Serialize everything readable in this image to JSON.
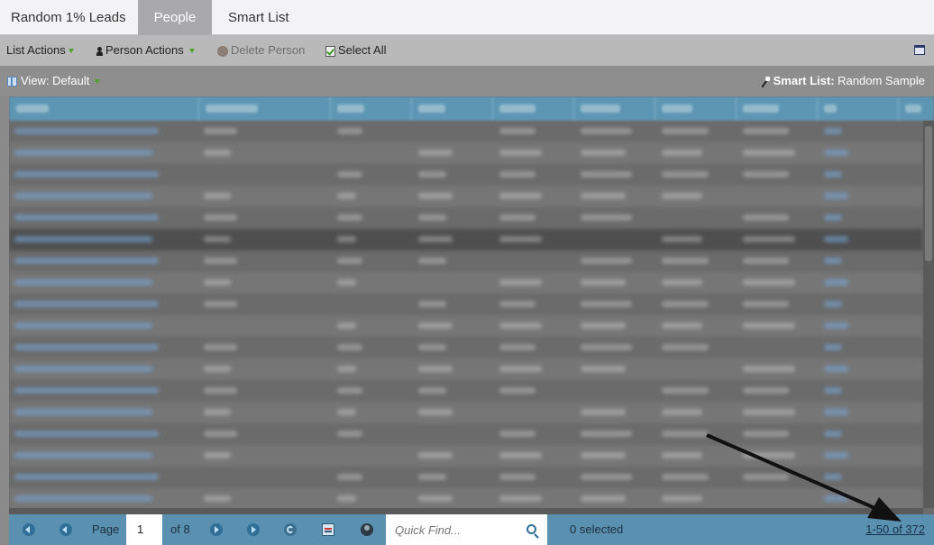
{
  "tabs": [
    {
      "label": "Random 1% Leads",
      "active": false
    },
    {
      "label": "People",
      "active": true
    },
    {
      "label": "Smart List",
      "active": false
    }
  ],
  "toolbar": {
    "list_actions": "List Actions",
    "person_actions": "Person Actions",
    "delete_person": "Delete Person",
    "select_all": "Select All"
  },
  "viewbar": {
    "view_label": "View: Default",
    "smart_list_prefix": "Smart List:",
    "smart_list_name": "Random Sample"
  },
  "footer": {
    "page_label": "Page",
    "page_value": "1",
    "of_pages": "of 8",
    "quick_find_placeholder": "Quick Find...",
    "selected_text": "0 selected",
    "record_count": "1-50 of 372"
  },
  "colors": {
    "accent_blue": "#5a90b0",
    "active_tab": "#a9a9ab",
    "indicator_green": "#4fa12a"
  },
  "icons": [
    "person-icon",
    "delete-person-icon",
    "select-all-check-icon",
    "window-icon",
    "grid-view-icon",
    "smart-list-wand-icon",
    "first-page-icon",
    "prev-page-icon",
    "next-page-icon",
    "last-page-icon",
    "refresh-icon",
    "export-icon",
    "person-lookup-icon",
    "search-icon"
  ]
}
